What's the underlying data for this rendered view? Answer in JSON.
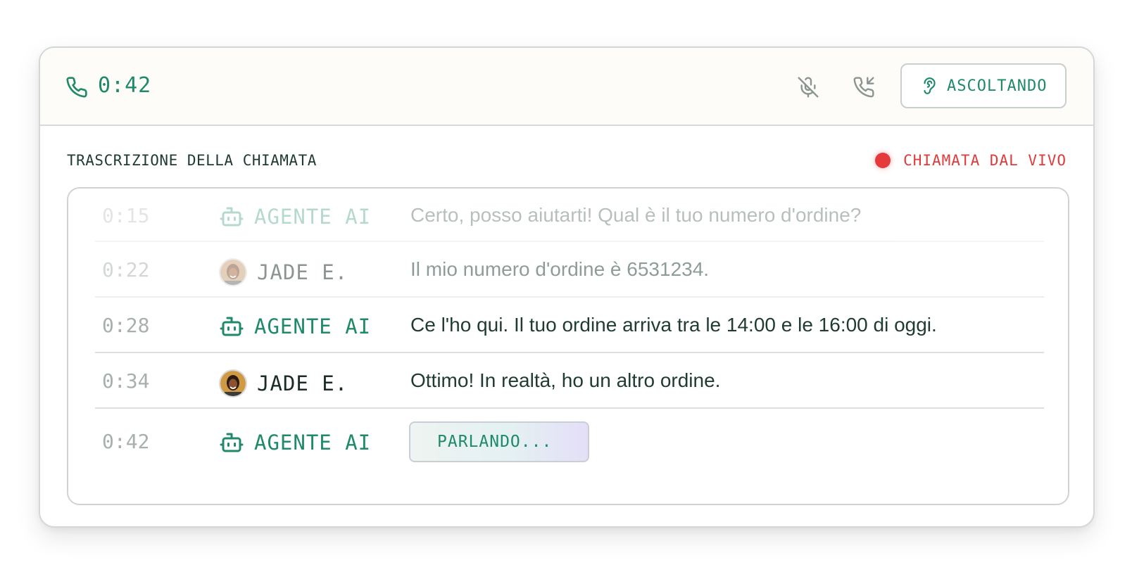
{
  "header": {
    "call_timer": "0:42",
    "listen_label": "ASCOLTANDO",
    "icons": [
      "phone-icon",
      "mic-off-icon",
      "phone-transfer-icon",
      "ear-icon"
    ],
    "accent_color": "#1f8a6a"
  },
  "transcript": {
    "title": "TRASCRIZIONE DELLA CHIAMATA",
    "live_label": "CHIAMATA DAL VIVO",
    "live_color": "#e5393b",
    "rows": [
      {
        "time": "0:15",
        "speaker": "AGENTE AI",
        "role": "agent",
        "text": "Certo, posso aiutarti! Qual è il tuo numero d'ordine?"
      },
      {
        "time": "0:22",
        "speaker": "JADE E.",
        "role": "user",
        "text": "Il mio numero d'ordine è 6531234."
      },
      {
        "time": "0:28",
        "speaker": "AGENTE AI",
        "role": "agent",
        "text": "Ce l'ho qui. Il tuo ordine arriva tra le 14:00 e le 16:00 di oggi."
      },
      {
        "time": "0:34",
        "speaker": "JADE E.",
        "role": "user",
        "text": "Ottimo! In realtà, ho un altro ordine."
      },
      {
        "time": "0:42",
        "speaker": "AGENTE AI",
        "role": "agent",
        "status": "PARLANDO..."
      }
    ]
  }
}
